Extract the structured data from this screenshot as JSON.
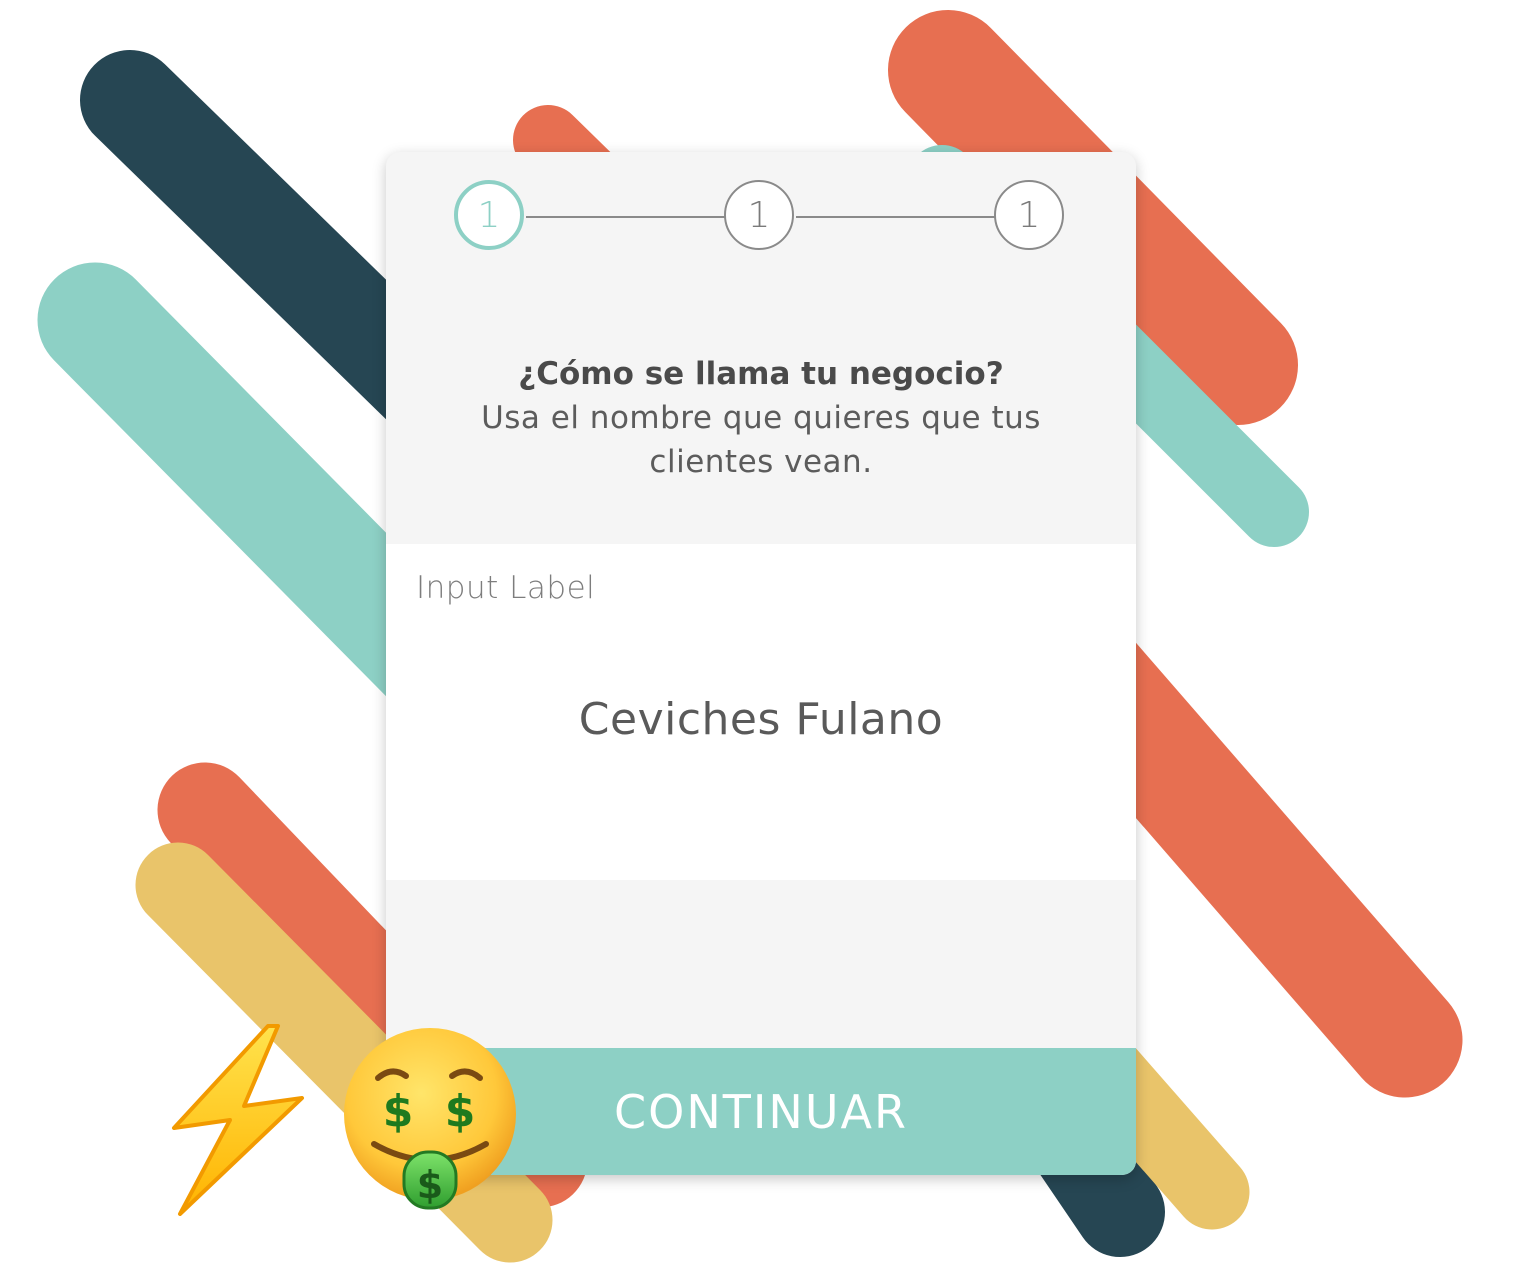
{
  "stepper": {
    "steps": [
      {
        "label": "1",
        "state": "active"
      },
      {
        "label": "1",
        "state": "inactive"
      },
      {
        "label": "1",
        "state": "inactive"
      }
    ]
  },
  "question": {
    "title": "¿Cómo se llama tu negocio?",
    "hint_line1": "Usa el nombre que quieres que tus",
    "hint_line2": "clientes vean."
  },
  "input": {
    "label": "Input Label",
    "value": "Ceviches Fulano"
  },
  "actions": {
    "continue_label": "CONTINUAR"
  },
  "decorations": {
    "emojis": [
      "lightning-bolt-icon",
      "money-mouth-face-icon"
    ],
    "stripe_colors": [
      "#264653",
      "#e76f51",
      "#8dd0c5",
      "#e9c46a"
    ]
  },
  "colors": {
    "accent": "#8dd0c5",
    "card_bg": "#f5f5f5",
    "text": "#555555"
  }
}
